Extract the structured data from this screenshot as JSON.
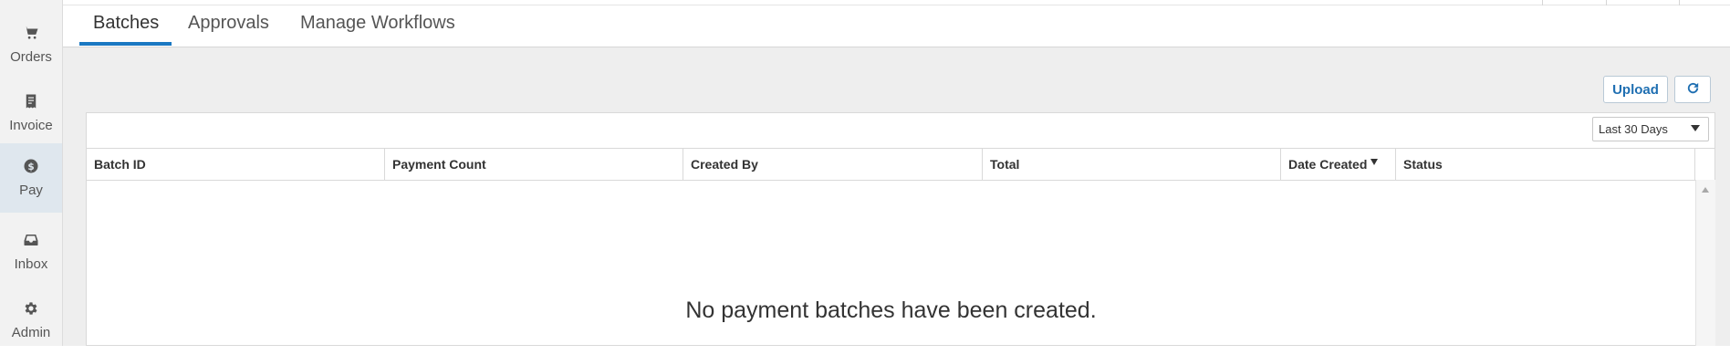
{
  "sidebar": {
    "items": [
      {
        "label": "Orders",
        "icon": "cart-icon"
      },
      {
        "label": "Invoice",
        "icon": "invoice-icon"
      },
      {
        "label": "Pay",
        "icon": "dollar-circle-icon",
        "active": true
      },
      {
        "label": "Inbox",
        "icon": "inbox-icon"
      },
      {
        "label": "Admin",
        "icon": "gear-icon"
      }
    ]
  },
  "tabs": [
    {
      "label": "Batches",
      "active": true
    },
    {
      "label": "Approvals"
    },
    {
      "label": "Manage Workflows"
    }
  ],
  "toolbar": {
    "upload_label": "Upload",
    "refresh_icon": "refresh-icon"
  },
  "filter": {
    "date_range": "Last 30 Days"
  },
  "table": {
    "columns": [
      "Batch ID",
      "Payment Count",
      "Created By",
      "Total",
      "Date Created",
      "Status"
    ],
    "sorted_column": "Date Created",
    "sort_direction": "descending",
    "rows": [],
    "empty_message": "No payment batches have been created."
  },
  "colors": {
    "accent": "#1a78c2",
    "content_bg": "#eeeeee",
    "sidebar_active_bg": "#dfe7ee"
  }
}
